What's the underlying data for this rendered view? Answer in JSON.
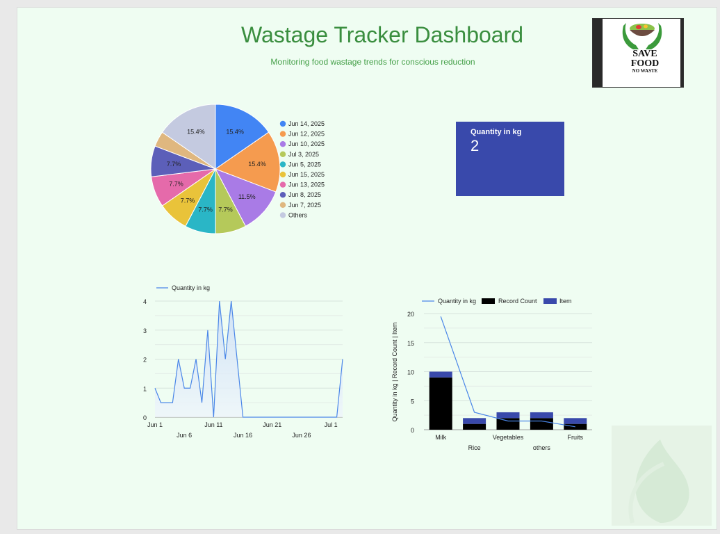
{
  "header": {
    "title": "Wastage Tracker Dashboard",
    "subtitle": "Monitoring food wastage trends for conscious reduction"
  },
  "logo": {
    "line1": "SAVE",
    "line2": "FOOD",
    "line3": "NO WASTE"
  },
  "kpi": {
    "label": "Quantity in kg",
    "value": "2",
    "color": "#3949ab"
  },
  "chart_data": [
    {
      "type": "pie",
      "slices": [
        {
          "label": "Jun 14, 2025",
          "value": 15.4,
          "pct_label": "15.4%",
          "color": "#4285f4"
        },
        {
          "label": "Jun 12, 2025",
          "value": 15.4,
          "pct_label": "15.4%",
          "color": "#f59b4f"
        },
        {
          "label": "Jun 10, 2025",
          "value": 11.5,
          "pct_label": "11.5%",
          "color": "#a97be6"
        },
        {
          "label": "Jul 3, 2025",
          "value": 7.7,
          "pct_label": "7.7%",
          "color": "#b5c95a"
        },
        {
          "label": "Jun 5, 2025",
          "value": 7.7,
          "pct_label": "7.7%",
          "color": "#2ab6c6"
        },
        {
          "label": "Jun 15, 2025",
          "value": 7.7,
          "pct_label": "7.7%",
          "color": "#e9c33a"
        },
        {
          "label": "Jun 13, 2025",
          "value": 7.7,
          "pct_label": "7.7%",
          "color": "#e56aaa"
        },
        {
          "label": "Jun 8, 2025",
          "value": 7.7,
          "pct_label": "7.7%",
          "color": "#5c5fb9"
        },
        {
          "label": "Jun 7, 2025",
          "value": 3.85,
          "pct_label": "",
          "color": "#dfb77f"
        },
        {
          "label": "Others",
          "value": 15.4,
          "pct_label": "15.4%",
          "color": "#c4cae0"
        }
      ]
    },
    {
      "type": "area",
      "series": [
        {
          "name": "Quantity in kg",
          "color": "#4a86e8"
        }
      ],
      "x": [
        "Jun 1",
        "Jun 2",
        "Jun 3",
        "Jun 4",
        "Jun 5",
        "Jun 6",
        "Jun 7",
        "Jun 8",
        "Jun 9",
        "Jun 10",
        "Jun 11",
        "Jun 12",
        "Jun 13",
        "Jun 14",
        "Jun 15",
        "Jun 16",
        "Jun 17",
        "Jun 18",
        "Jun 19",
        "Jun 20",
        "Jun 21",
        "Jun 22",
        "Jun 23",
        "Jun 24",
        "Jun 25",
        "Jun 26",
        "Jun 27",
        "Jun 28",
        "Jun 29",
        "Jun 30",
        "Jul 1",
        "Jul 2",
        "Jul 3"
      ],
      "values": [
        1,
        0.5,
        0.5,
        0.5,
        2,
        1,
        1,
        2,
        0.5,
        3,
        0,
        4,
        2,
        4,
        2,
        0,
        0,
        0,
        0,
        0,
        0,
        0,
        0,
        0,
        0,
        0,
        0,
        0,
        0,
        0,
        0,
        0,
        2
      ],
      "xticks_top": [
        "Jun 1",
        "Jun 11",
        "Jun 21",
        "Jul 1"
      ],
      "xticks_bottom": [
        "Jun 6",
        "Jun 16",
        "Jun 26"
      ],
      "yticks": [
        "0",
        "1",
        "2",
        "3",
        "4"
      ],
      "ylim": [
        0,
        4
      ]
    },
    {
      "type": "bar",
      "legend": [
        "Quantity in kg",
        "Record Count",
        "Item"
      ],
      "ylabel": "Quantity in kg | Record Count | Item",
      "categories_top": [
        "Milk",
        "Vegetables",
        "Fruits"
      ],
      "categories_bottom": [
        "Rice",
        "others"
      ],
      "categories": [
        "Milk",
        "Rice",
        "Vegetables",
        "others",
        "Fruits"
      ],
      "record_count": [
        9,
        1,
        2,
        2,
        1
      ],
      "item": [
        1,
        1,
        1,
        1,
        1
      ],
      "quantity": [
        19.5,
        3,
        1.5,
        1.5,
        0.5
      ],
      "yticks": [
        "0",
        "5",
        "10",
        "15",
        "20"
      ],
      "ylim": [
        0,
        20
      ],
      "colors": {
        "quantity": "#4a86e8",
        "record": "#000000",
        "item": "#3949ab"
      }
    }
  ]
}
